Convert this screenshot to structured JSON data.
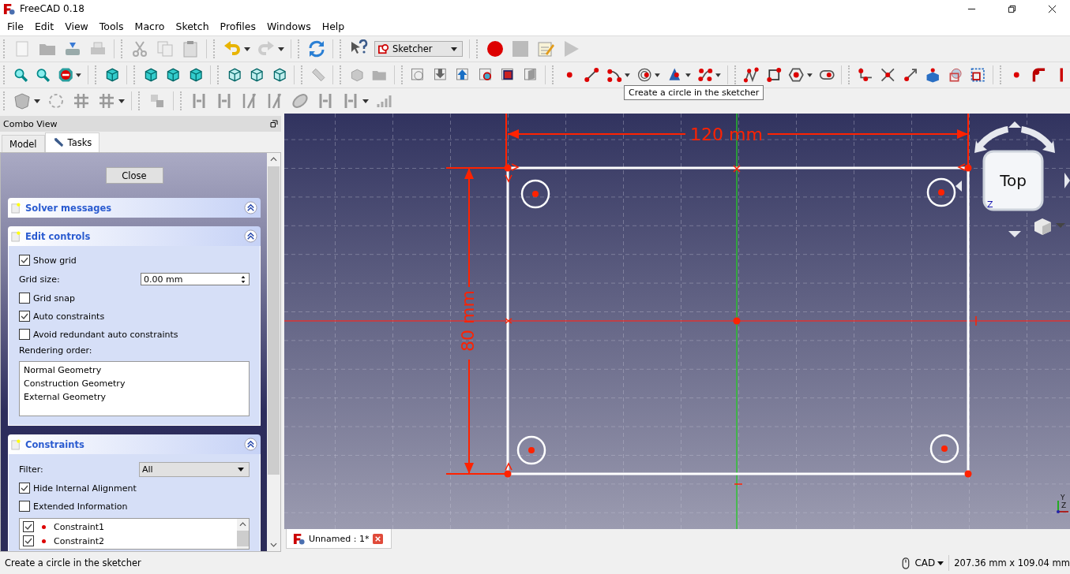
{
  "window": {
    "title": "FreeCAD 0.18"
  },
  "menu": [
    "File",
    "Edit",
    "View",
    "Tools",
    "Macro",
    "Sketch",
    "Profiles",
    "Windows",
    "Help"
  ],
  "workbench": {
    "value": "Sketcher"
  },
  "tooltip": "Create a circle in the sketcher",
  "combo_view": {
    "title": "Combo View",
    "tabs": [
      {
        "label": "Model",
        "selected": false
      },
      {
        "label": "Tasks",
        "selected": true
      }
    ]
  },
  "task_panel": {
    "close_button": "Close",
    "solver_messages": {
      "title": "Solver messages"
    },
    "edit_controls": {
      "title": "Edit controls",
      "items": [
        {
          "kind": "checkbox",
          "label": "Show grid",
          "checked": true
        },
        {
          "kind": "spinbox",
          "label": "Grid size:",
          "value": "0.00 mm"
        },
        {
          "kind": "checkbox",
          "label": "Grid snap",
          "checked": false
        },
        {
          "kind": "checkbox",
          "label": "Auto constraints",
          "checked": true
        },
        {
          "kind": "checkbox",
          "label": "Avoid redundant auto constraints",
          "checked": false
        },
        {
          "kind": "list",
          "label": "Rendering order:",
          "entries": [
            "Normal Geometry",
            "Construction Geometry",
            "External Geometry"
          ]
        }
      ]
    },
    "constraints": {
      "title": "Constraints",
      "filter_label": "Filter:",
      "filter_value": "All",
      "options": [
        {
          "label": "Hide Internal Alignment",
          "checked": true
        },
        {
          "label": "Extended Information",
          "checked": false
        }
      ],
      "list": [
        {
          "label": "Constraint1",
          "checked": true
        },
        {
          "label": "Constraint2",
          "checked": true
        }
      ]
    }
  },
  "viewport": {
    "horizontal_dimension": "120 mm",
    "vertical_dimension": "80 mm",
    "nav_cube_face": "Top",
    "nav_cube_axis": "Z",
    "axis_labels": [
      "Y",
      "Z"
    ]
  },
  "document_tab": {
    "label": "Unnamed : 1*"
  },
  "status_bar": {
    "message": "Create a circle in the sketcher",
    "navigation_style": "CAD",
    "dimensions": "207.36 mm x 109.04 mm"
  }
}
